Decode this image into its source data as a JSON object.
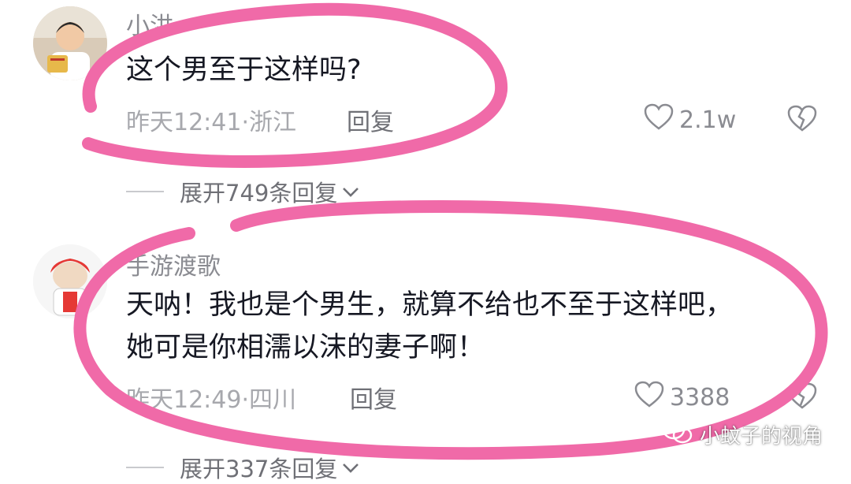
{
  "comments": [
    {
      "author": "小洪",
      "text_lines": [
        "这个男至于这样吗?"
      ],
      "meta": "昨天12:41·浙江",
      "reply_label": "回复",
      "likes": "2.1w",
      "expand_label": "展开749条回复"
    },
    {
      "author": "手游渡歌",
      "text_lines": [
        "天呐！我也是个男生，就算不给也不至于这样吧，",
        "她可是你相濡以沫的妻子啊！"
      ],
      "meta": "昨天12:49·四川",
      "reply_label": "回复",
      "likes": "3388",
      "expand_label": "展开337条回复"
    }
  ],
  "watermark": {
    "text": "小蚊子的视角",
    "icon": "wechat-icon"
  },
  "colors": {
    "annotation": "#f06aa8",
    "muted": "#a7a8ad",
    "text": "#161823"
  }
}
